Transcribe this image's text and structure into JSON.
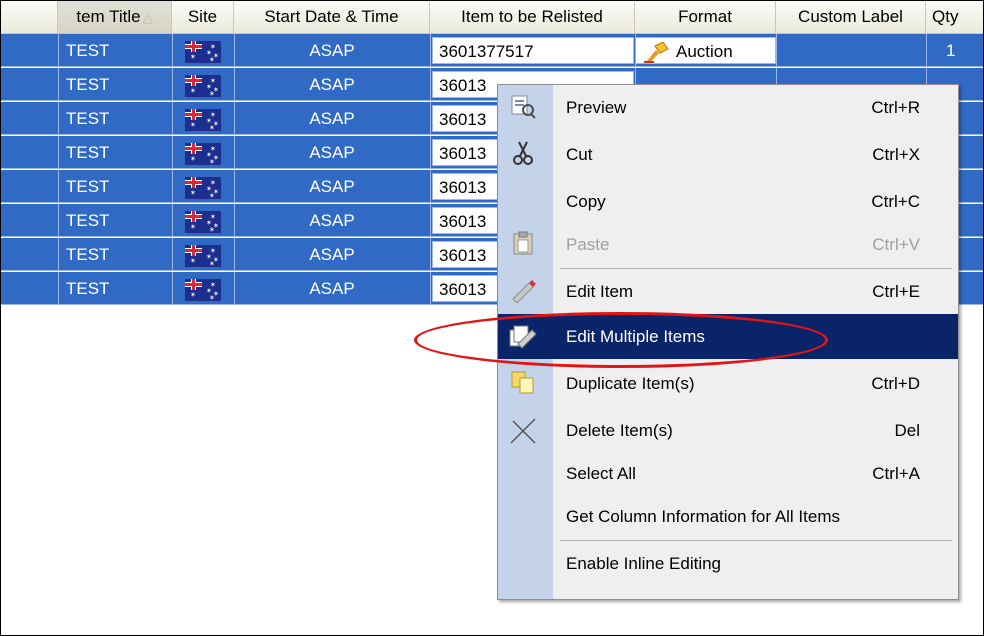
{
  "columns": [
    {
      "label": "tem Title",
      "sorted": true
    },
    {
      "label": "Site"
    },
    {
      "label": "Start Date & Time"
    },
    {
      "label": "Item to be Relisted"
    },
    {
      "label": "Format"
    },
    {
      "label": "Custom Label"
    },
    {
      "label": "Qty"
    }
  ],
  "sort_glyph": "△",
  "rows": [
    {
      "title": "TEST",
      "start": "ASAP",
      "item": "3601377517",
      "format": "Auction",
      "qty": "1"
    },
    {
      "title": "TEST",
      "start": "ASAP",
      "item": "36013",
      "format": "",
      "qty": ""
    },
    {
      "title": "TEST",
      "start": "ASAP",
      "item": "36013",
      "format": "",
      "qty": ""
    },
    {
      "title": "TEST",
      "start": "ASAP",
      "item": "36013",
      "format": "",
      "qty": ""
    },
    {
      "title": "TEST",
      "start": "ASAP",
      "item": "36013",
      "format": "",
      "qty": ""
    },
    {
      "title": "TEST",
      "start": "ASAP",
      "item": "36013",
      "format": "",
      "qty": ""
    },
    {
      "title": "TEST",
      "start": "ASAP",
      "item": "36013",
      "format": "",
      "qty": ""
    },
    {
      "title": "TEST",
      "start": "ASAP",
      "item": "36013",
      "format": "",
      "qty": ""
    }
  ],
  "site_icon": "australian-flag-icon",
  "format_icon": "auction-gavel-icon",
  "context_menu": {
    "items": [
      {
        "label": "Preview",
        "shortcut": "Ctrl+R",
        "icon": "preview-icon"
      },
      {
        "label": "Cut",
        "shortcut": "Ctrl+X",
        "icon": "scissors-icon"
      },
      {
        "label": "Copy",
        "shortcut": "Ctrl+C",
        "icon": ""
      },
      {
        "label": "Paste",
        "shortcut": "Ctrl+V",
        "icon": "clipboard-icon",
        "disabled": true
      },
      {
        "label": "Edit Item",
        "shortcut": "Ctrl+E",
        "icon": "edit-pencil-icon"
      },
      {
        "label": "Edit Multiple Items",
        "shortcut": "",
        "icon": "edit-multiple-icon",
        "selected": true
      },
      {
        "label": "Duplicate Item(s)",
        "shortcut": "Ctrl+D",
        "icon": "duplicate-icon"
      },
      {
        "label": "Delete Item(s)",
        "shortcut": "Del",
        "icon": "delete-x-icon"
      },
      {
        "label": "Select All",
        "shortcut": "Ctrl+A",
        "icon": ""
      },
      {
        "label": "Get Column Information for All Items",
        "shortcut": "",
        "icon": ""
      },
      {
        "label": "Enable Inline Editing",
        "shortcut": "",
        "icon": ""
      }
    ]
  },
  "colors": {
    "selection": "#316ac5",
    "menu_highlight": "#0a246a",
    "annotation": "#e01515"
  }
}
